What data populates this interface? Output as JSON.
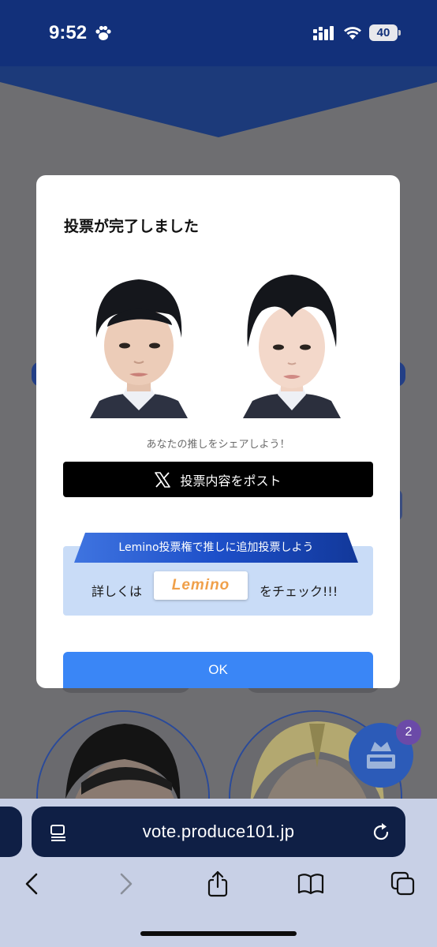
{
  "status_bar": {
    "time": "9:52",
    "battery": "40"
  },
  "modal": {
    "title": "投票が完了しました",
    "share_caption": "あなたの推しをシェアしよう！",
    "post_button_label": "投票内容をポスト",
    "lemino": {
      "ribbon_text": "Lemino投票権で推しに追加投票しよう",
      "pre_text": "詳しくは",
      "logo_text": "Lemino",
      "post_text": "をチェック!!!"
    },
    "ok_label": "OK"
  },
  "floating_button": {
    "badge_count": "2"
  },
  "browser": {
    "url": "vote.produce101.jp"
  }
}
